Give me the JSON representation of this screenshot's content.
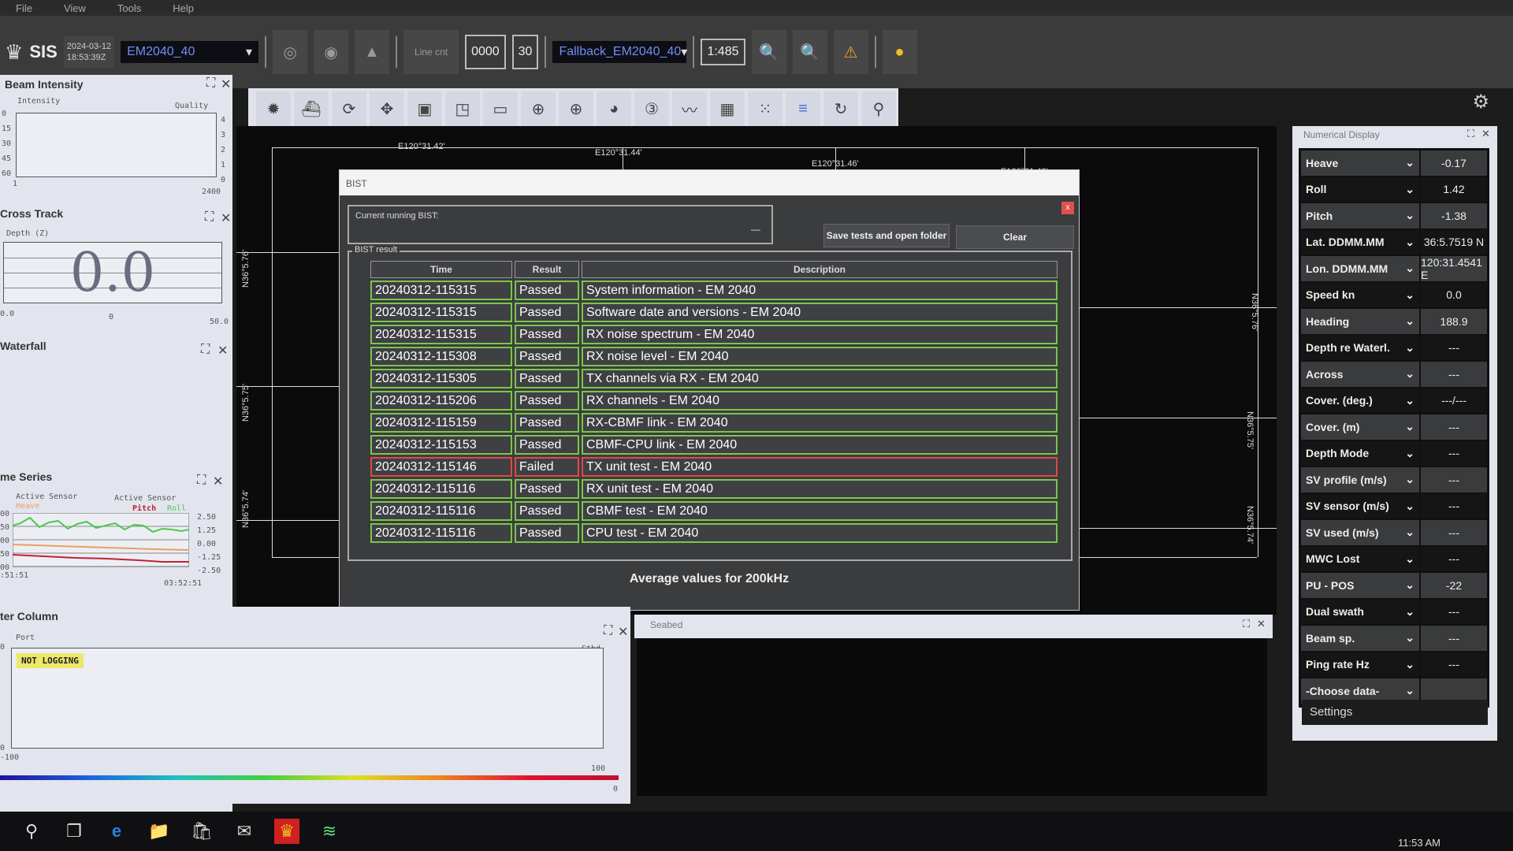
{
  "menu": [
    "File",
    "View",
    "Tools",
    "Help"
  ],
  "app": {
    "name": "SIS",
    "date": "2024-03-12",
    "time": "18:53:39Z",
    "sounder": "EM2040_40",
    "line_cnt_label": "Line cnt",
    "line_cnt": "0000",
    "line_num": "30",
    "fallback": "Fallback_EM2040_40",
    "scale": "1:485"
  },
  "toolbar_icons": [
    "settings-a-icon",
    "vessel-icon",
    "rotate-icon",
    "pan-icon",
    "window-icon",
    "resize-icon",
    "ruler-icon",
    "crosshair-d-icon",
    "crosshair-p-icon",
    "palette-icon",
    "3d-icon",
    "line-icon",
    "grid-icon",
    "dots-icon",
    "layers-icon",
    "refresh-icon",
    "pin-icon"
  ],
  "beam_intensity": {
    "title": "Beam Intensity",
    "y_label": "Intensity",
    "y2_label": "Quality",
    "y_ticks": [
      "0",
      "15",
      "30",
      "45",
      "60"
    ],
    "y2_ticks": [
      "4",
      "3",
      "2",
      "1",
      "0"
    ],
    "x_min": "1",
    "x_max": "2400"
  },
  "cross_track": {
    "title": "Cross Track",
    "y_label": "Depth (Z)",
    "value": "0.0",
    "x_left": "0.0",
    "x_mid": "0",
    "x_right": "50.0"
  },
  "waterfall": {
    "title": "Waterfall"
  },
  "time_series": {
    "title": "me Series",
    "left_label": "Active Sensor",
    "left_series": "Heave",
    "right_label": "Active Sensor",
    "right_series_1": "Pitch",
    "right_series_2": "Roll",
    "y_left": [
      "00",
      "50",
      "00",
      "50",
      "00"
    ],
    "y_right": [
      "2.50",
      "1.25",
      "0.00",
      "-1.25",
      "-2.50"
    ],
    "t_start": ":51:51",
    "t_end": "03:52:51",
    "colors": {
      "heave": "#e8a060",
      "pitch": "#c0203a",
      "roll": "#4cc84c"
    }
  },
  "water_column": {
    "title": "ter Column",
    "port": "Port",
    "stbd": "Stbd",
    "status": "NOT LOGGING",
    "y_top": "0",
    "y_bottom": "0",
    "x_min": "-100",
    "x_max": "100",
    "scale_end": "0"
  },
  "seabed": {
    "title": "Seabed"
  },
  "map": {
    "top": [
      "E120°31.42'",
      "E120°31.44'",
      "E120°31.46'",
      "E120°31.48'"
    ],
    "left": [
      "N36°5.76'",
      "N36°5.75'",
      "N36°5.74'"
    ],
    "right": [
      "N36°5.76'",
      "N36°5.75'",
      "N36°5.74'"
    ]
  },
  "bist": {
    "title": "BIST",
    "current_label": "Current running BIST:",
    "current_value": "—",
    "result_label": "BIST result",
    "save_button": "Save tests and open folder",
    "clear_button": "Clear",
    "close": "x",
    "columns": [
      "Time",
      "Result",
      "Description"
    ],
    "rows": [
      [
        "20240312-115315",
        "Passed",
        "System information - EM 2040"
      ],
      [
        "20240312-115315",
        "Passed",
        "Software date and versions - EM 2040"
      ],
      [
        "20240312-115315",
        "Passed",
        "RX noise spectrum - EM 2040"
      ],
      [
        "20240312-115308",
        "Passed",
        "RX noise level - EM 2040"
      ],
      [
        "20240312-115305",
        "Passed",
        "TX channels via RX - EM 2040"
      ],
      [
        "20240312-115206",
        "Passed",
        "RX channels - EM 2040"
      ],
      [
        "20240312-115159",
        "Passed",
        "RX-CBMF link - EM 2040"
      ],
      [
        "20240312-115153",
        "Passed",
        "CBMF-CPU link - EM 2040"
      ],
      [
        "20240312-115146",
        "Failed",
        "TX unit test - EM 2040"
      ],
      [
        "20240312-115116",
        "Passed",
        "RX unit test - EM 2040"
      ],
      [
        "20240312-115116",
        "Passed",
        "CBMF test - EM 2040"
      ],
      [
        "20240312-115116",
        "Passed",
        "CPU test - EM 2040"
      ]
    ],
    "average_label": "Average values for 200kHz",
    "pass_color": "#7cc54a",
    "fail_color": "#e04848"
  },
  "numerical": {
    "title": "Numerical Display",
    "settings": "Settings",
    "rows": [
      [
        "Heave",
        "-0.17"
      ],
      [
        "Roll",
        "1.42"
      ],
      [
        "Pitch",
        "-1.38"
      ],
      [
        "Lat. DDMM.MM",
        "36:5.7519 N"
      ],
      [
        "Lon. DDMM.MM",
        "120:31.4541 E"
      ],
      [
        "Speed kn",
        "0.0"
      ],
      [
        "Heading",
        "188.9"
      ],
      [
        "Depth re Waterl.",
        "---"
      ],
      [
        "Across",
        "---"
      ],
      [
        "Cover. (deg.)",
        "---/---"
      ],
      [
        "Cover. (m)",
        "---"
      ],
      [
        "Depth Mode",
        "---"
      ],
      [
        "SV profile (m/s)",
        "---"
      ],
      [
        "SV sensor (m/s)",
        "---"
      ],
      [
        "SV used (m/s)",
        "---"
      ],
      [
        "MWC Lost",
        "---"
      ],
      [
        "PU - POS",
        "-22"
      ],
      [
        "Dual swath",
        "---"
      ],
      [
        "Beam sp.",
        "---"
      ],
      [
        "Ping rate Hz",
        "---"
      ],
      [
        "-Choose data-",
        ""
      ]
    ]
  },
  "taskbar": {
    "clock": "11:53 AM",
    "icons": [
      "search-icon",
      "task-view-icon",
      "edge-icon",
      "file-explorer-icon",
      "store-icon",
      "mail-icon",
      "kongsberg-icon",
      "sis-app-icon"
    ]
  }
}
